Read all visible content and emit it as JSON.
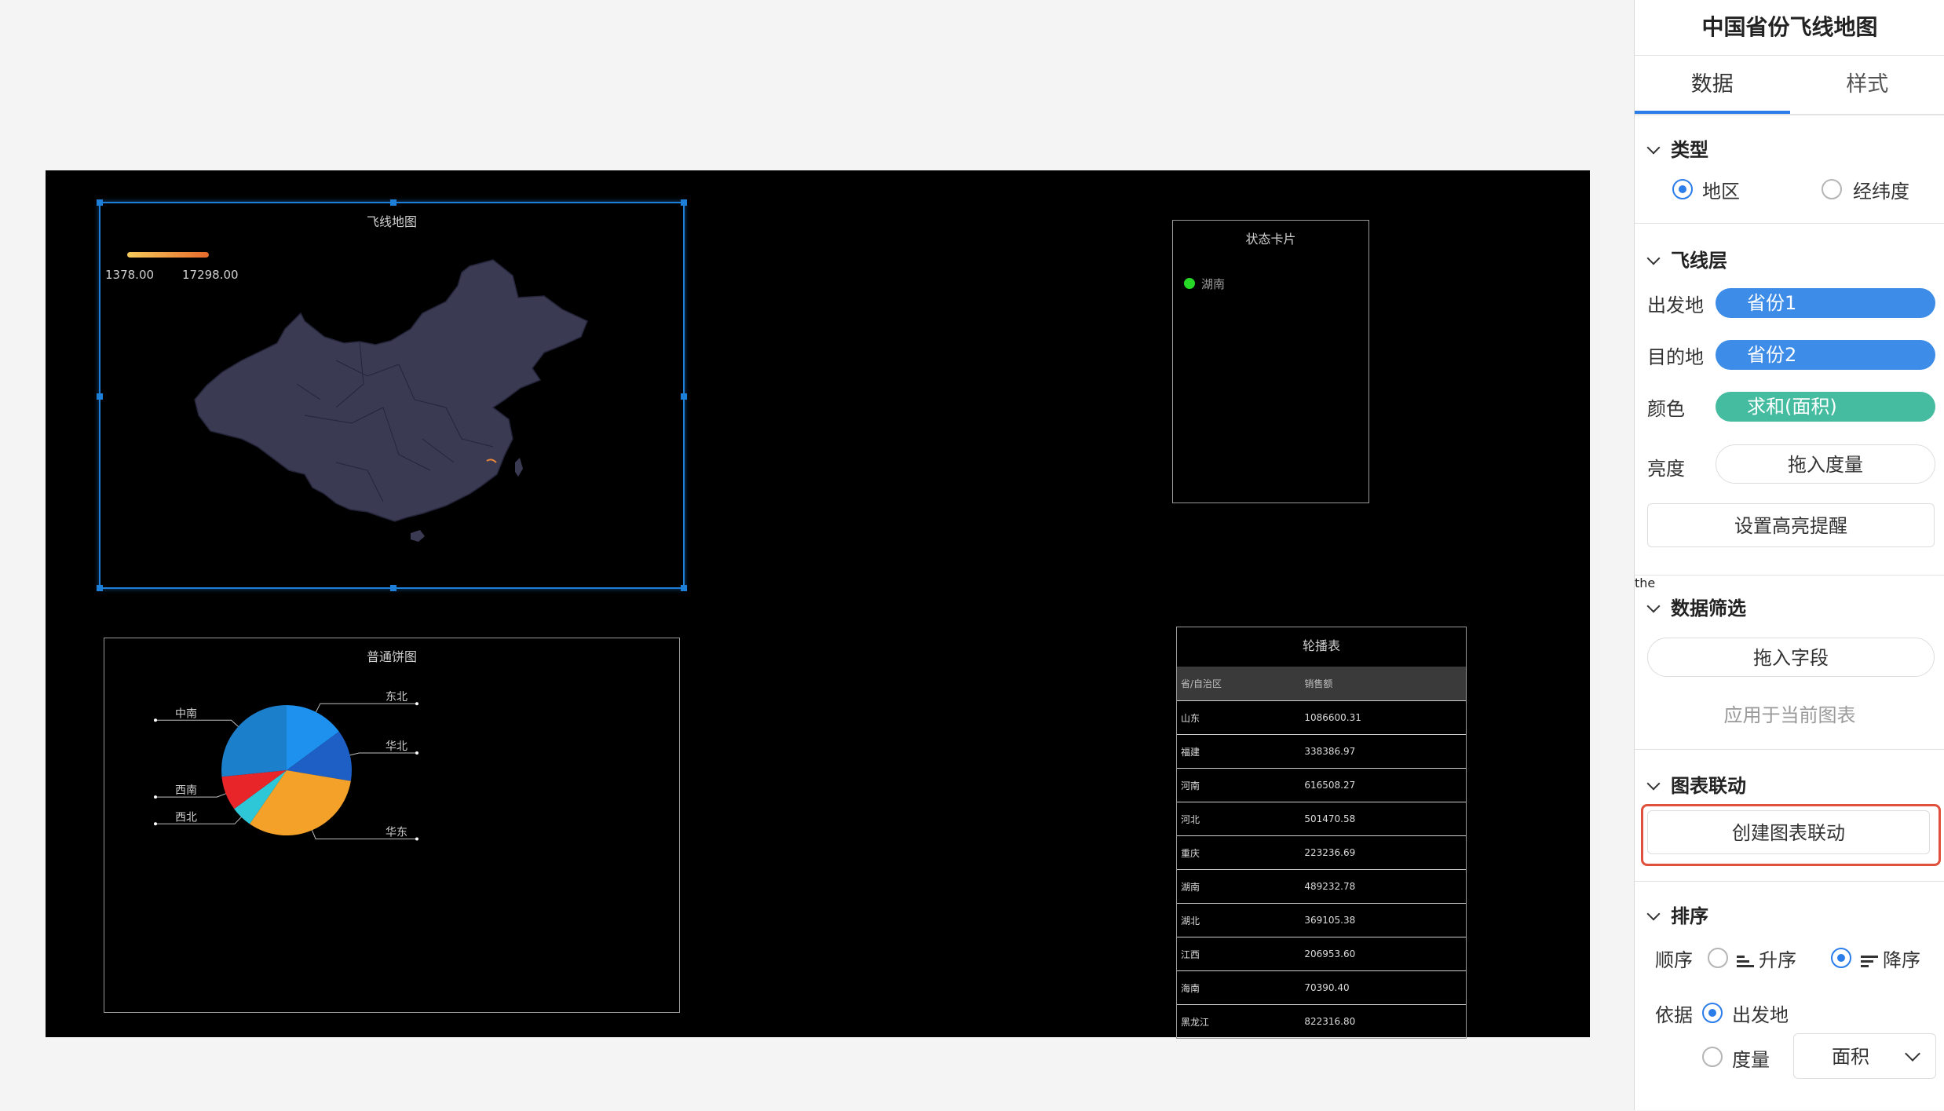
{
  "canvas": {
    "flight_map": {
      "title": "飞线地图",
      "legend_min": "1378.00",
      "legend_max": "17298.00"
    },
    "status_card": {
      "title": "状态卡片",
      "item": "湖南",
      "dot_color": "#26d926"
    },
    "pie": {
      "title": "普通饼图"
    },
    "carousel": {
      "title": "轮播表",
      "headers": [
        "省/自治区",
        "销售额"
      ],
      "rows": [
        [
          "山东",
          "1086600.31"
        ],
        [
          "福建",
          "338386.97"
        ],
        [
          "河南",
          "616508.27"
        ],
        [
          "河北",
          "501470.58"
        ],
        [
          "重庆",
          "223236.69"
        ],
        [
          "湖南",
          "489232.78"
        ],
        [
          "湖北",
          "369105.38"
        ],
        [
          "江西",
          "206953.60"
        ],
        [
          "海南",
          "70390.40"
        ],
        [
          "黑龙江",
          "822316.80"
        ]
      ]
    }
  },
  "chart_data": {
    "type": "pie",
    "title": "普通饼图",
    "slices": [
      {
        "label": "东北",
        "value": 14,
        "color": "#1e90ee"
      },
      {
        "label": "华北",
        "value": 12,
        "color": "#1d5fc5"
      },
      {
        "label": "华东",
        "value": 30,
        "color": "#f3a129"
      },
      {
        "label": "西北",
        "value": 5,
        "color": "#2ec7d8"
      },
      {
        "label": "西南",
        "value": 8,
        "color": "#e8262a"
      },
      {
        "label": "中南",
        "value": 25,
        "color": "#1b7fcc"
      }
    ]
  },
  "panel": {
    "title": "中国省份飞线地图",
    "tabs": [
      "数据",
      "样式"
    ],
    "type_section": {
      "title": "类型",
      "options": [
        "地区",
        "经纬度"
      ]
    },
    "flight_section": {
      "title": "飞线层",
      "origin_label": "出发地",
      "origin_value": "省份1",
      "dest_label": "目的地",
      "dest_value": "省份2",
      "color_label": "颜色",
      "color_value": "求和(面积)",
      "brightness_label": "亮度",
      "brightness_placeholder": "拖入度量",
      "highlight_button": "设置高亮提醒",
      "pill_blue": "#3d8ce8",
      "pill_green": "#45bca0"
    },
    "filter_section": {
      "title": "数据筛选",
      "drop_field": "拖入字段",
      "apply": "应用于当前图表"
    },
    "link_section": {
      "title": "图表联动",
      "create_button": "创建图表联动"
    },
    "sort_section": {
      "title": "排序",
      "order_label": "顺序",
      "asc": "升序",
      "desc": "降序",
      "basis_label": "依据",
      "basis_origin": "出发地",
      "basis_measure": "度量",
      "measure_select": "面积"
    }
  }
}
